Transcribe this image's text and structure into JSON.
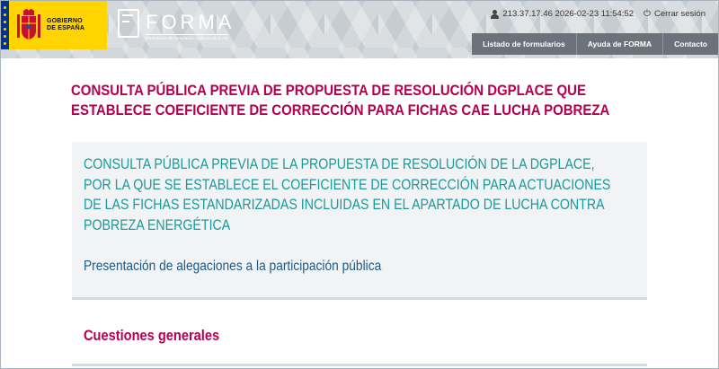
{
  "header": {
    "gov_logo_text": "GOBIERNO\nDE ESPAÑA",
    "app_name": "FORMA",
    "app_subtitle": "Formularios de Ordenación y Mejora de la Administración",
    "session": {
      "ip_time": "213.37.17.46 2026-02-23 11:54:52",
      "logout_label": "Cerrar sesión"
    },
    "nav": [
      {
        "label": "Listado de formularios"
      },
      {
        "label": "Ayuda de FORMA"
      },
      {
        "label": "Contacto"
      }
    ]
  },
  "page": {
    "title": "CONSULTA PÚBLICA PREVIA DE PROPUESTA DE RESOLUCIÓN DGPLACE QUE ESTABLECE COEFICIENTE DE CORRECCIÓN PARA FICHAS CAE LUCHA POBREZA",
    "heading": "CONSULTA PÚBLICA PREVIA DE LA PROPUESTA DE RESOLUCIÓN DE LA DGPLACE, POR LA QUE SE ESTABLECE EL COEFICIENTE DE CORRECCIÓN PARA ACTUACIONES DE LAS FICHAS ESTANDARIZADAS INCLUIDAS EN EL APARTADO DE LUCHA CONTRA POBREZA ENERGÉTICA",
    "subheading": "Presentación de alegaciones a la participación pública",
    "section_title": "Cuestiones generales"
  },
  "colors": {
    "title": "#b5004f",
    "heading": "#1a9a9a",
    "subheading": "#1b5a88",
    "nav_bg": "#6b727a",
    "gov_yellow": "#ffd400"
  }
}
